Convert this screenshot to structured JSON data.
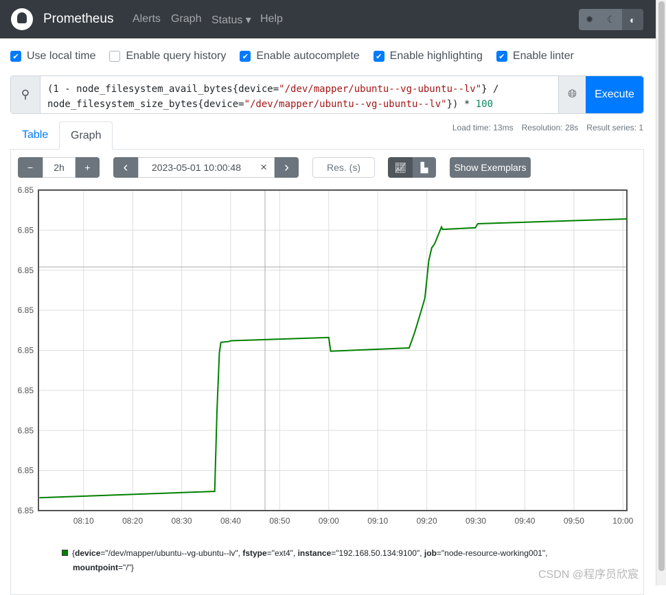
{
  "nav": {
    "brand": "Prometheus",
    "links": [
      "Alerts",
      "Graph",
      "Status ▾",
      "Help"
    ],
    "theme_icons": [
      "sun-icon",
      "moon-icon",
      "contrast-icon"
    ]
  },
  "options": [
    {
      "label": "Use local time",
      "checked": true
    },
    {
      "label": "Enable query history",
      "checked": false
    },
    {
      "label": "Enable autocomplete",
      "checked": true
    },
    {
      "label": "Enable highlighting",
      "checked": true
    },
    {
      "label": "Enable linter",
      "checked": true
    }
  ],
  "query": {
    "line1_a": "(1 - node_filesystem_avail_bytes{device=",
    "line1_s": "\"/dev/mapper/ubuntu--vg-ubuntu--lv\"",
    "line1_b": "} /",
    "line2_a": "node_filesystem_size_bytes{device=",
    "line2_s": "\"/dev/mapper/ubuntu--vg-ubuntu--lv\"",
    "line2_b": "}) * ",
    "line2_n": "100",
    "execute": "Execute"
  },
  "stats": {
    "load": "Load time: 13ms",
    "resolution": "Resolution: 28s",
    "series": "Result series: 1"
  },
  "tabs": {
    "table": "Table",
    "graph": "Graph"
  },
  "controls": {
    "minus": "−",
    "range": "2h",
    "plus": "+",
    "prev": "‹",
    "end_time": "2023-05-01 10:00:48",
    "clear": "×",
    "next": "›",
    "res_placeholder": "Res. (s)",
    "exemplars": "Show Exemplars"
  },
  "chart_data": {
    "type": "line",
    "ylim": [
      6.849,
      6.853
    ],
    "yticks": [
      6.849,
      6.8495,
      6.85,
      6.8505,
      6.851,
      6.8515,
      6.852,
      6.8525,
      6.853
    ],
    "ytick_labels": [
      "6.85",
      "6.85",
      "6.85",
      "6.85",
      "6.85",
      "6.85",
      "6.85",
      "6.85",
      "6.85"
    ],
    "xlim": [
      "08:00:48",
      "10:00:48"
    ],
    "xtick_labels": [
      "08:10",
      "08:20",
      "08:30",
      "08:40",
      "08:50",
      "09:00",
      "09:10",
      "09:20",
      "09:30",
      "09:40",
      "09:50",
      "10:00"
    ],
    "grid": true,
    "color": "#008000",
    "series": [
      {
        "points": [
          [
            "08:01:00",
            6.84916
          ],
          [
            "08:36:45",
            6.84924
          ],
          [
            "08:37:12",
            6.85024
          ],
          [
            "08:37:42",
            6.85097
          ],
          [
            "08:38:00",
            6.8511
          ],
          [
            "08:39:33",
            6.85111
          ],
          [
            "08:40:06",
            6.85112
          ],
          [
            "09:00:00",
            6.85116
          ],
          [
            "09:00:24",
            6.85099
          ],
          [
            "09:16:24",
            6.85103
          ],
          [
            "09:17:30",
            6.85122
          ],
          [
            "09:18:36",
            6.85144
          ],
          [
            "09:19:36",
            6.85165
          ],
          [
            "09:20:24",
            6.85212
          ],
          [
            "09:21:00",
            6.85228
          ],
          [
            "09:21:36",
            6.85233
          ],
          [
            "09:23:00",
            6.85254
          ],
          [
            "09:23:12",
            6.85251
          ],
          [
            "09:29:54",
            6.85253
          ],
          [
            "09:30:24",
            6.85258
          ],
          [
            "10:00:48",
            6.85264
          ]
        ]
      }
    ]
  },
  "legend": {
    "open": "{",
    "k1": "device",
    "v1": "=\"/dev/mapper/ubuntu--vg-ubuntu--lv\", ",
    "k2": "fstype",
    "v2": "=\"ext4\", ",
    "k3": "instance",
    "v3": "=\"192.168.50.134:9100\", ",
    "k4": "job",
    "v4": "=\"node-resource-working001\",",
    "k5": "mountpoint",
    "v5": "=\"/\"}"
  },
  "watermark": "CSDN @程序员欣宸"
}
